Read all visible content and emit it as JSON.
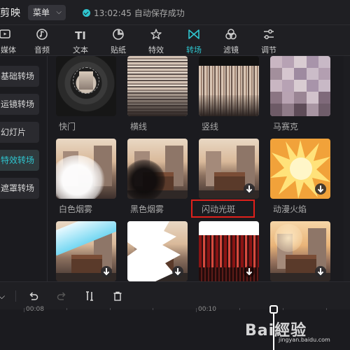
{
  "app": {
    "title": "剪映"
  },
  "menu": {
    "label": "菜单"
  },
  "save_status": {
    "time": "13:02:45",
    "text": "自动保存成功"
  },
  "tabs": [
    {
      "label": "媒体",
      "icon": "media-icon"
    },
    {
      "label": "音频",
      "icon": "audio-icon"
    },
    {
      "label": "文本",
      "icon": "text-icon"
    },
    {
      "label": "贴纸",
      "icon": "sticker-icon"
    },
    {
      "label": "特效",
      "icon": "effects-icon"
    },
    {
      "label": "转场",
      "icon": "transition-icon",
      "active": true
    },
    {
      "label": "滤镜",
      "icon": "filter-icon"
    },
    {
      "label": "调节",
      "icon": "adjust-icon"
    }
  ],
  "sidebar": {
    "items": [
      {
        "label": "基础转场"
      },
      {
        "label": "运镜转场"
      },
      {
        "label": "幻灯片"
      },
      {
        "label": "特效转场",
        "active": true
      },
      {
        "label": "遮罩转场"
      }
    ]
  },
  "effects": {
    "items": [
      {
        "name": "快门"
      },
      {
        "name": "横线"
      },
      {
        "name": "竖线"
      },
      {
        "name": "马赛克"
      },
      {
        "name": "白色烟雾"
      },
      {
        "name": "黑色烟雾"
      },
      {
        "name": "闪动光斑",
        "highlighted": true
      },
      {
        "name": "动漫火焰"
      },
      {
        "name": ""
      },
      {
        "name": ""
      },
      {
        "name": ""
      },
      {
        "name": ""
      }
    ]
  },
  "timeline": {
    "ticks": [
      "00:08",
      "00:10"
    ]
  },
  "watermark": {
    "main": "Bai經验",
    "sub": "jingyan.baidu.com"
  },
  "colors": {
    "accent": "#2fc5cf",
    "highlight_box": "#e0201b"
  }
}
